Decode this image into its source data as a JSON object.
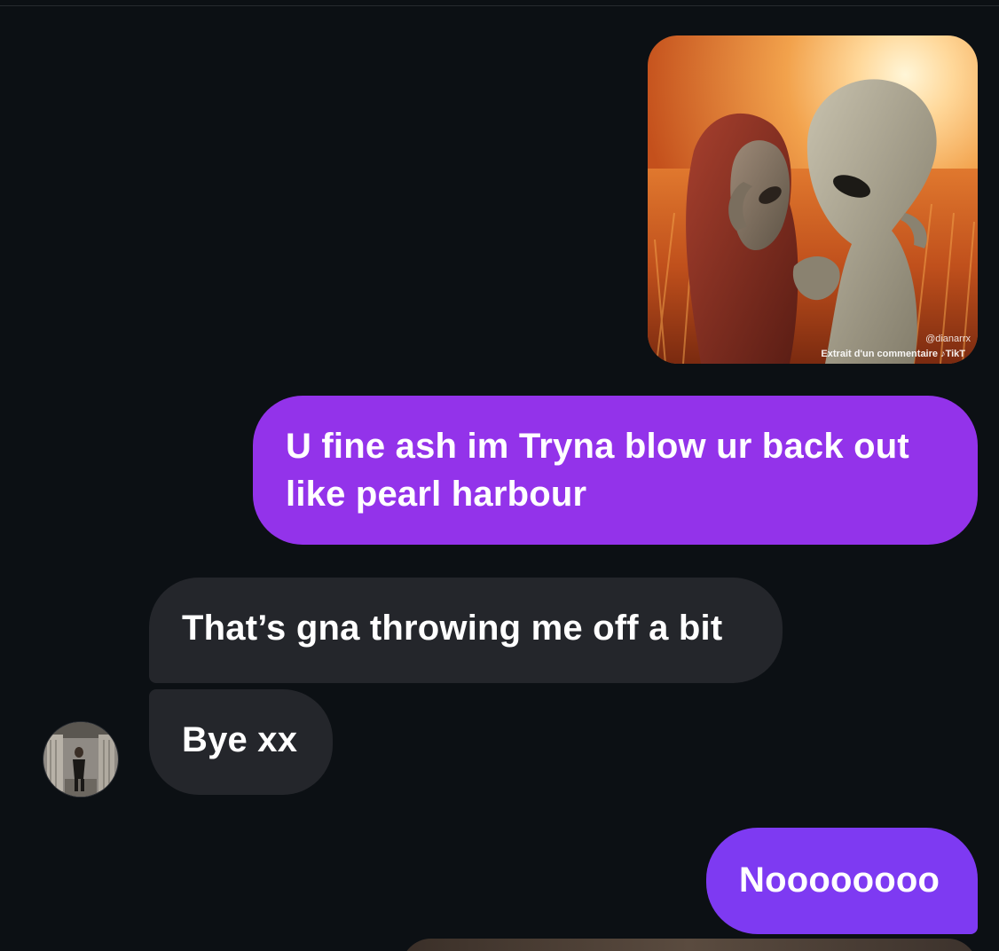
{
  "conversation": {
    "shared_image": {
      "watermark_user": "@dianarrx",
      "watermark_caption": "Extrait d'un commentaire",
      "watermark_brand": "TikT"
    },
    "messages": [
      {
        "direction": "outgoing",
        "text": "U fine ash im Tryna blow ur back out like pearl harbour"
      },
      {
        "direction": "incoming",
        "text": "That’s gna throwing me off a bit"
      },
      {
        "direction": "incoming",
        "text": "Bye xx"
      },
      {
        "direction": "outgoing",
        "text": "Noooooooo"
      }
    ]
  },
  "colors": {
    "background": "#0c1014",
    "outgoing_bubble": "#9333ea",
    "outgoing_bubble_last": "#7e3af2",
    "incoming_bubble": "#24262b",
    "text": "#ffffff"
  },
  "icons": {
    "tiktok": "tiktok-logo-icon"
  }
}
